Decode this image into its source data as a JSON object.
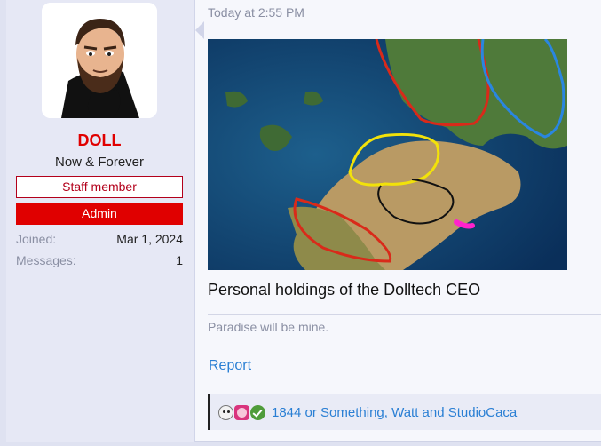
{
  "user": {
    "name": "DOLL",
    "title": "Now & Forever",
    "staff_banner": "Staff member",
    "admin_banner": "Admin",
    "joined_label": "Joined:",
    "joined_value": "Mar 1, 2024",
    "messages_label": "Messages:",
    "messages_value": "1"
  },
  "post": {
    "timestamp": "Today at 2:55 PM",
    "caption": "Personal holdings of the Dolltech CEO",
    "signature": "Paradise will be mine.",
    "report_label": "Report"
  },
  "reactions": {
    "icons": [
      "skull-icon",
      "face-icon",
      "check-icon"
    ],
    "users_text": "1844 or Something, Watt and StudioCaca"
  },
  "colors": {
    "username": "#e00000",
    "admin_banner": "#e00000",
    "staff_border": "#b3001b",
    "link": "#2a7fd4"
  }
}
